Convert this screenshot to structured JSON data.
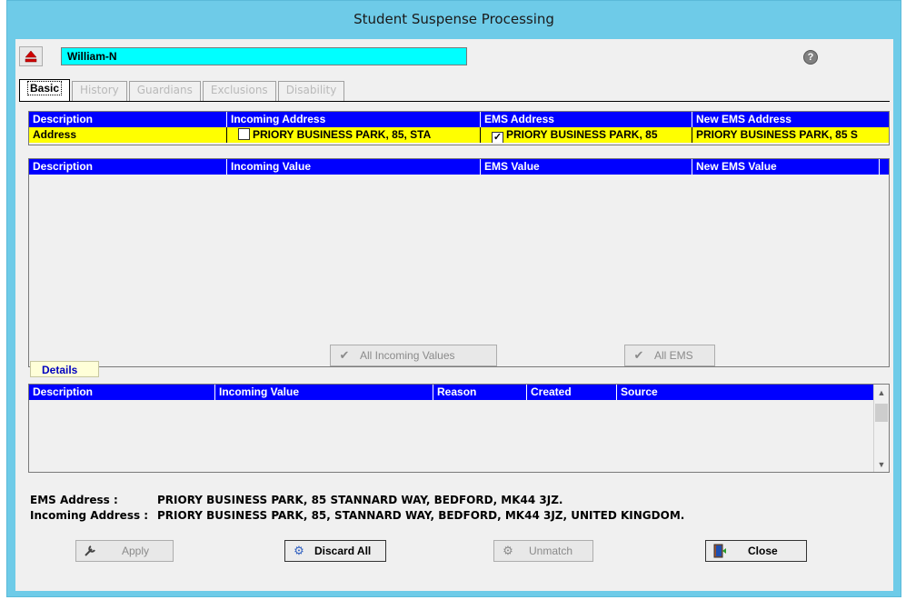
{
  "window": {
    "title": "Student Suspense Processing"
  },
  "student": {
    "name": "William-N"
  },
  "icons": {
    "eject": "eject-icon",
    "help": "help-icon"
  },
  "colors": {
    "header_blue": "#0000ff",
    "row_yellow": "#ffff00",
    "student_cyan": "#00ffff",
    "title_bar": "#6ecbe8"
  },
  "tabs": [
    {
      "label": "Basic",
      "active": true
    },
    {
      "label": "History",
      "active": false
    },
    {
      "label": "Guardians",
      "active": false
    },
    {
      "label": "Exclusions",
      "active": false
    },
    {
      "label": "Disability",
      "active": false
    }
  ],
  "address_grid": {
    "headers": [
      "Description",
      "Incoming Address",
      "EMS Address",
      "New EMS Address"
    ],
    "row": {
      "description": "Address",
      "incoming_checked": false,
      "incoming": "PRIORY BUSINESS PARK, 85, STA",
      "ems_checked": true,
      "ems": "PRIORY BUSINESS PARK, 85",
      "new_ems": "PRIORY BUSINESS PARK, 85 S"
    }
  },
  "values_grid": {
    "headers": [
      "Description",
      "Incoming Value",
      "EMS Value",
      "New EMS Value"
    ]
  },
  "buttons": {
    "all_incoming": "All Incoming Values",
    "all_ems": "All EMS",
    "apply": "Apply",
    "discard_all": "Discard All",
    "unmatch": "Unmatch",
    "close": "Close"
  },
  "details": {
    "tab_label": "Details",
    "headers": [
      "Description",
      "Incoming Value",
      "Reason",
      "Created",
      "Source"
    ]
  },
  "info": {
    "ems_label": "EMS Address :",
    "ems_value": "PRIORY BUSINESS PARK, 85 STANNARD WAY, BEDFORD, MK44 3JZ.",
    "incoming_label": "Incoming Address :",
    "incoming_value": "PRIORY BUSINESS PARK, 85, STANNARD WAY, BEDFORD, MK44 3JZ, UNITED KINGDOM."
  }
}
